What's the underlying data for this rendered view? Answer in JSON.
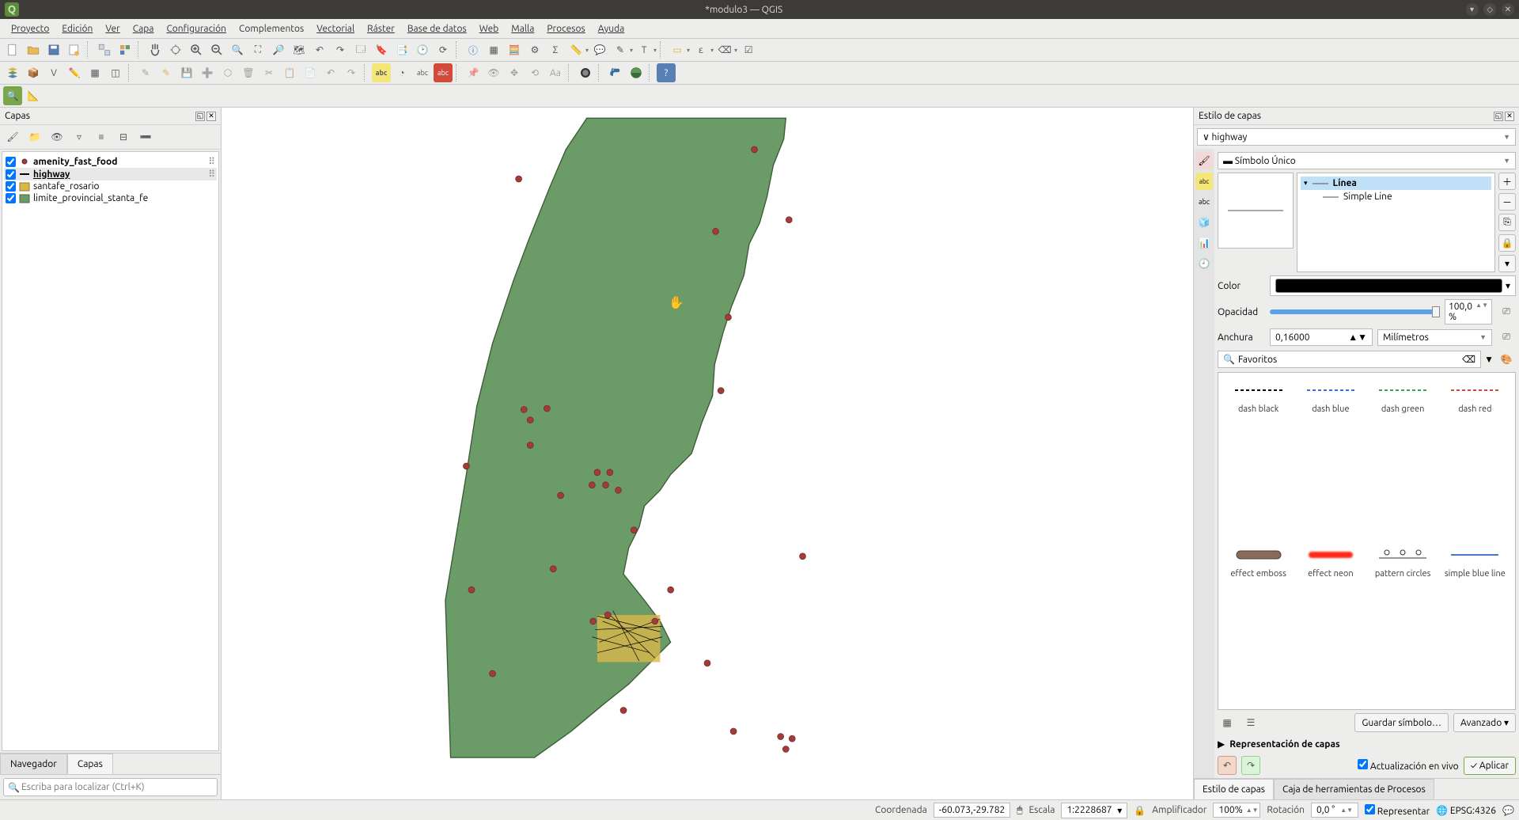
{
  "window": {
    "title": "*modulo3 — QGIS"
  },
  "menu": [
    "Proyecto",
    "Edición",
    "Ver",
    "Capa",
    "Configuración",
    "Complementos",
    "Vectorial",
    "Ráster",
    "Base de datos",
    "Web",
    "Malla",
    "Procesos",
    "Ayuda"
  ],
  "panels": {
    "layers_title": "Capas",
    "browser_tab": "Navegador",
    "layers_tab": "Capas"
  },
  "layers": [
    {
      "name": "amenity_fast_food",
      "checked": true,
      "sym": "point",
      "color": "#a33b3b"
    },
    {
      "name": "highway",
      "checked": true,
      "sym": "line",
      "color": "#000",
      "active": true
    },
    {
      "name": "santafe_rosario",
      "checked": true,
      "sym": "poly",
      "color": "#d9b84a"
    },
    {
      "name": "limite_provincial_stanta_fe",
      "checked": true,
      "sym": "poly",
      "color": "#6b9b66"
    }
  ],
  "locator": {
    "placeholder": "Escriba para localizar (Ctrl+K)"
  },
  "styling": {
    "title": "Estilo de capas",
    "layer_selected": "highway",
    "renderer": "Símbolo Único",
    "hier": {
      "root": "Línea",
      "child": "Simple Line"
    },
    "color_label": "Color",
    "opacity_label": "Opacidad",
    "opacity_value": "100,0 %",
    "width_label": "Anchura",
    "width_value": "0,16000",
    "width_unit": "Milímetros",
    "fav_label": "Favoritos",
    "save_btn": "Guardar símbolo…",
    "adv_btn": "Avanzado",
    "repcapas": "Representación de capas",
    "live_label": "Actualización en vivo",
    "apply_btn": "Aplicar",
    "tab_style": "Estilo de capas",
    "tab_processing": "Caja de herramientas de Procesos"
  },
  "swatches": [
    {
      "name": "dash  black",
      "kind": "dash",
      "color": "#000"
    },
    {
      "name": "dash blue",
      "kind": "dash",
      "color": "#3b6fd1"
    },
    {
      "name": "dash green",
      "kind": "dash",
      "color": "#3fa35a"
    },
    {
      "name": "dash red",
      "kind": "dash",
      "color": "#d14a3b"
    },
    {
      "name": "effect emboss",
      "kind": "emboss"
    },
    {
      "name": "effect neon",
      "kind": "neon"
    },
    {
      "name": "pattern circles",
      "kind": "circles"
    },
    {
      "name": "simple blue line",
      "kind": "solid",
      "color": "#4a77c9"
    }
  ],
  "statusbar": {
    "coord_label": "Coordenada",
    "coord_value": "-60.073,-29.782",
    "scale_label": "Escala",
    "scale_value": "1:2228687",
    "mag_label": "Amplificador",
    "mag_value": "100%",
    "rot_label": "Rotación",
    "rot_value": "0,0 °",
    "render_label": "Representar",
    "crs": "EPSG:4326"
  }
}
